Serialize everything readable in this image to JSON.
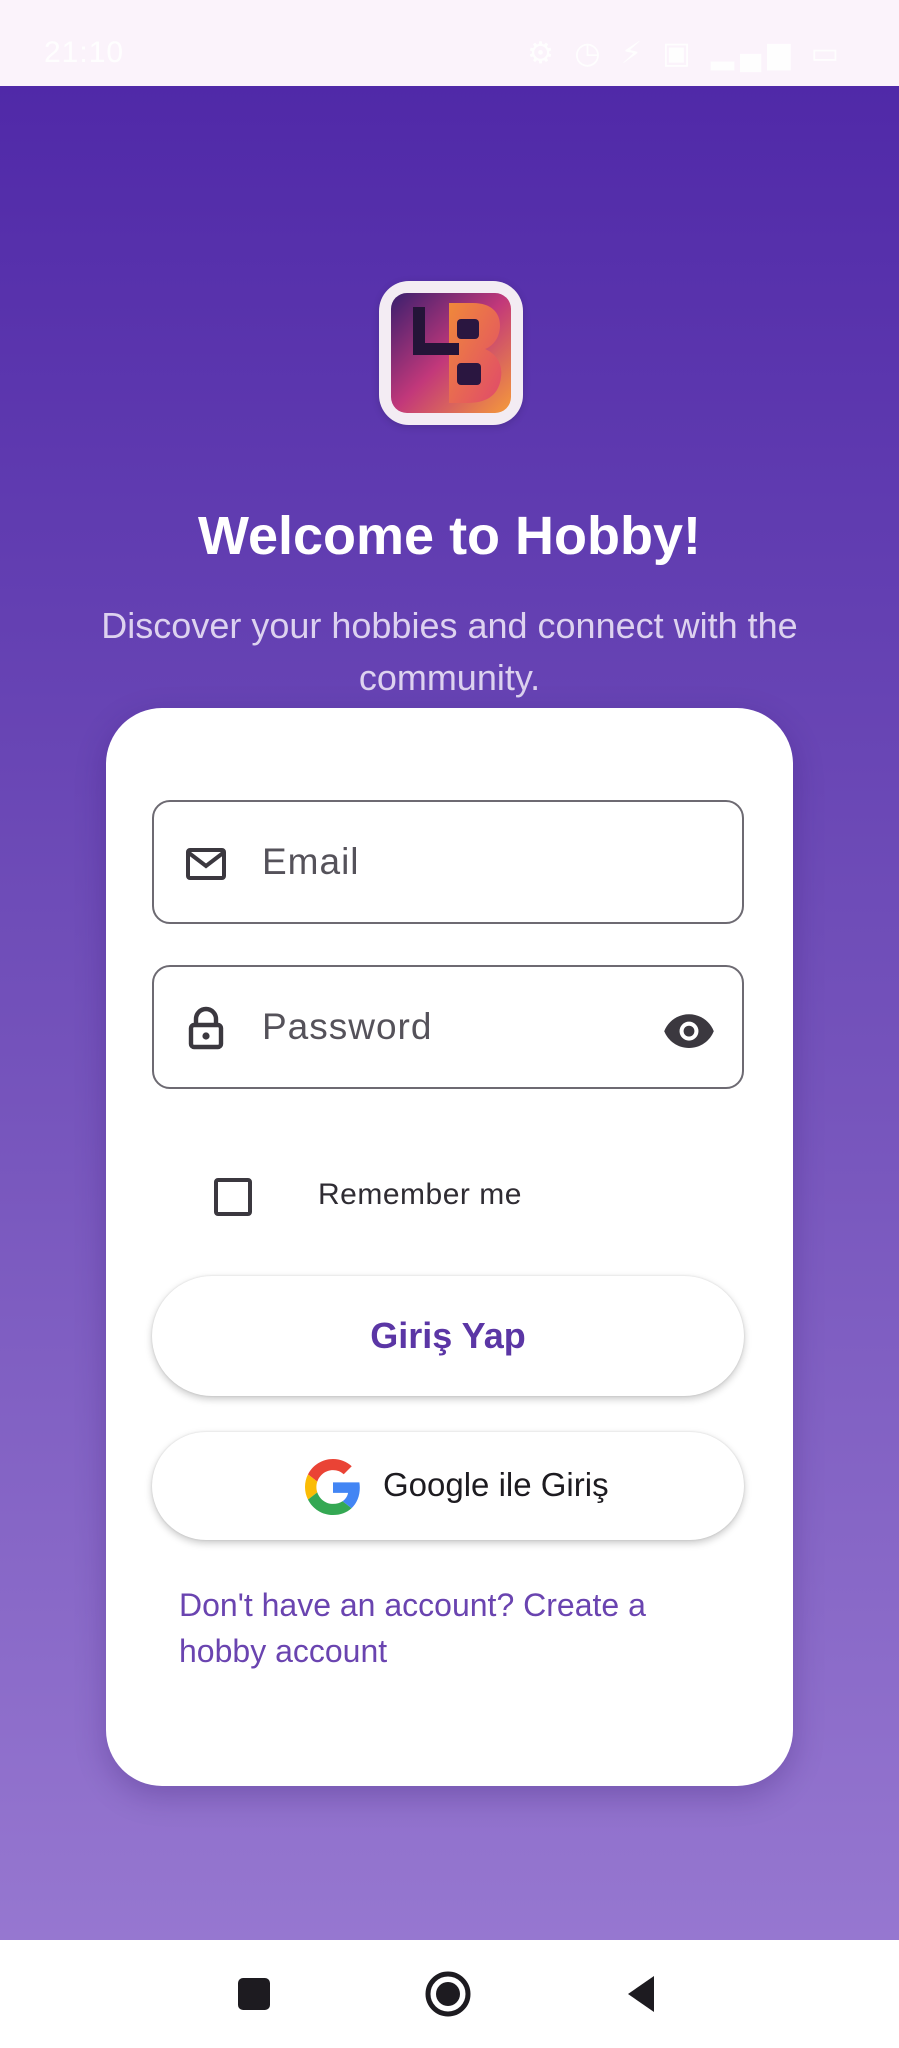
{
  "status_bar": {
    "time": "21:10",
    "icons": "⚙ ◷ ⚡ ▣ ▂▄▆ ▭"
  },
  "welcome": {
    "title": "Welcome to Hobby!",
    "subtitle": "Discover your hobbies and connect with the community."
  },
  "login_form": {
    "email_placeholder": "Email",
    "email_value": "",
    "password_placeholder": "Password",
    "password_value": "",
    "remember_label": "Remember me",
    "remember_checked": false,
    "login_button": "Giriş Yap",
    "google_button": "Google ile Giriş",
    "signup_link": "Don't have an account? Create a hobby account"
  },
  "icons": {
    "email": "mail-icon",
    "password": "lock-icon",
    "visibility": "eye-icon",
    "google": "google-g-icon",
    "logo": "hobby-hb-logo"
  },
  "colors": {
    "gradient_top": "#5029a8",
    "gradient_bottom": "#9677d0",
    "accent": "#5b36a5",
    "card": "#ffffff"
  }
}
